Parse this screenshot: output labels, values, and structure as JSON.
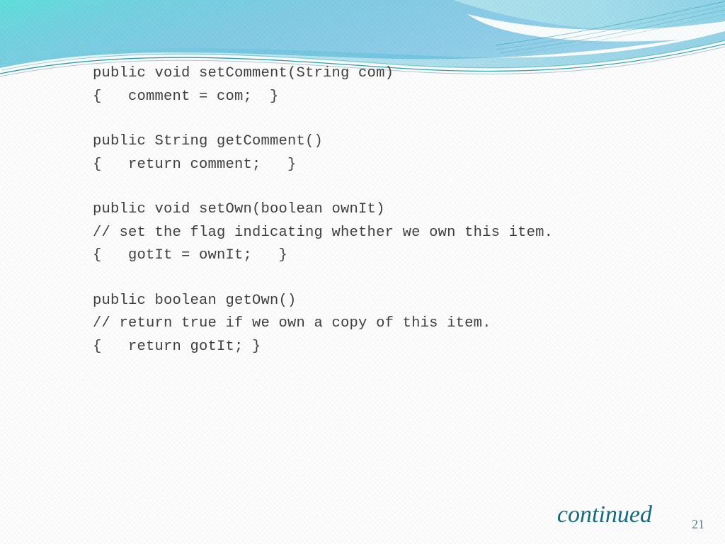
{
  "slide": {
    "page_number": "21",
    "footer_note": "continued",
    "accent_color": "#156b7c",
    "page_number_color": "#5d7f86",
    "code_text_color": "#3f3f3f",
    "header_gradient_from": "#5fe0dc",
    "header_gradient_to": "#8fcfe8",
    "background_color": "#fdfdfd"
  },
  "code_blocks": [
    {
      "name": "set-comment-method",
      "lines": [
        "public void setComment(String com)",
        "{   comment = com;  }"
      ]
    },
    {
      "name": "get-comment-method",
      "lines": [
        "public String getComment()",
        "{   return comment;   }"
      ]
    },
    {
      "name": "set-own-method",
      "lines": [
        "public void setOwn(boolean ownIt)",
        "// set the flag indicating whether we own this item.",
        "{   gotIt = ownIt;   }"
      ]
    },
    {
      "name": "get-own-method",
      "lines": [
        "public boolean getOwn()",
        "// return true if we own a copy of this item.",
        "{   return gotIt; }"
      ]
    }
  ]
}
